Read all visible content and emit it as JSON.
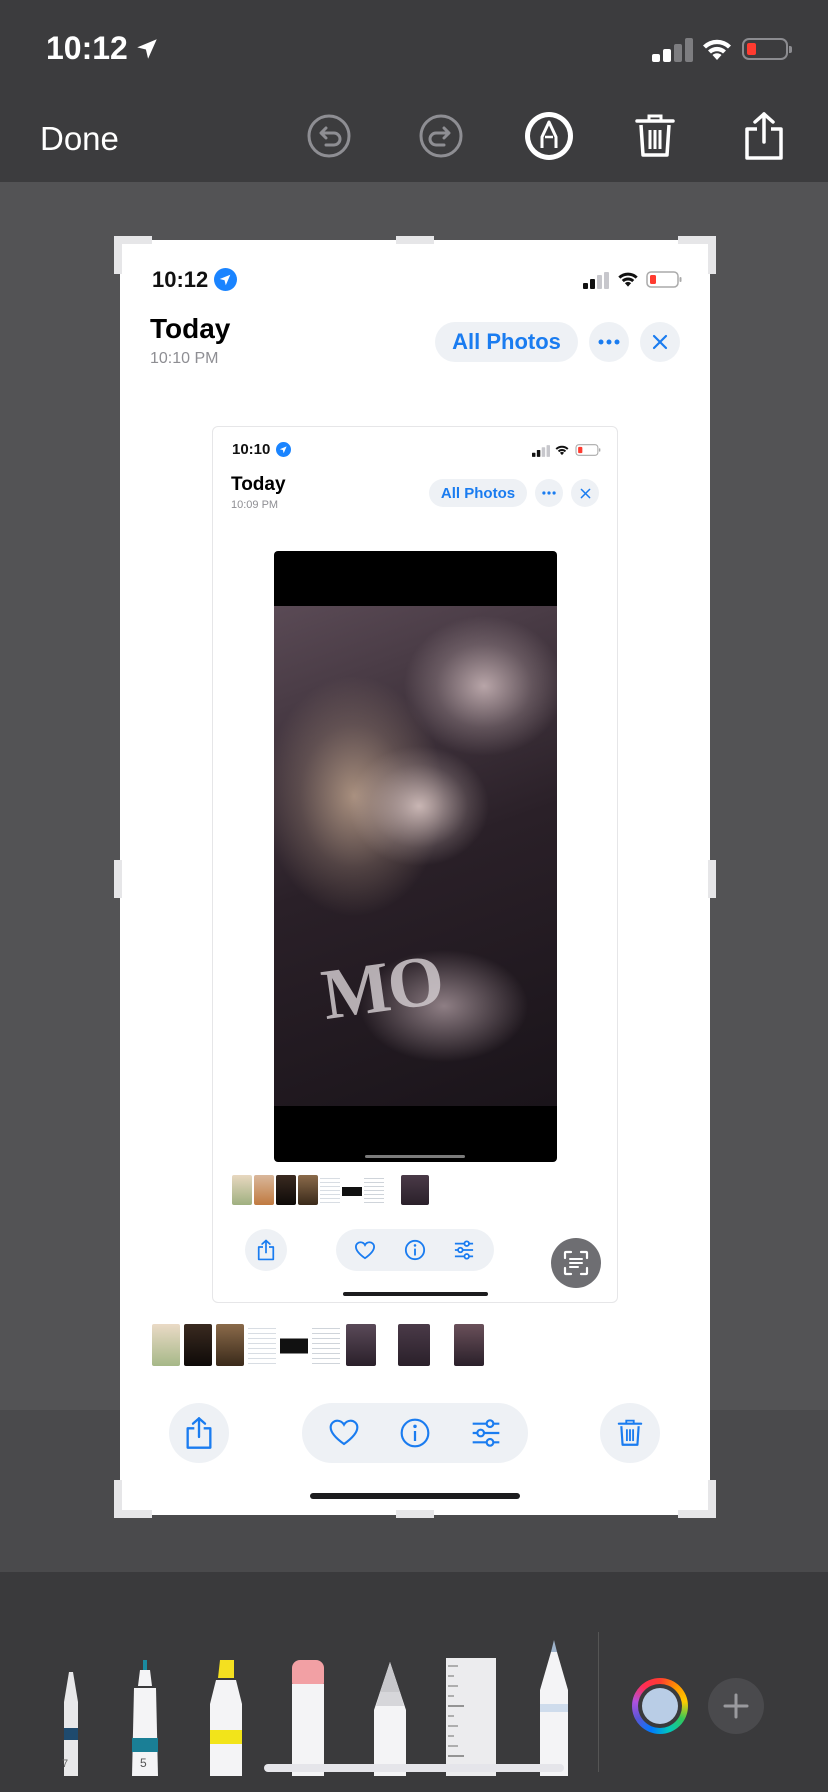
{
  "status_bar": {
    "time": "10:12"
  },
  "toolbar": {
    "done_label": "Done"
  },
  "screenshot": {
    "status_time": "10:12",
    "title": "Today",
    "subtitle": "10:10 PM",
    "all_photos_label": "All Photos",
    "nested": {
      "status_time": "10:10",
      "title": "Today",
      "subtitle": "10:09 PM",
      "all_photos_label": "All Photos",
      "photo_text": "MO"
    }
  },
  "tools": {
    "pen_label_1": "7",
    "pen_label_2": "5"
  },
  "colors": {
    "accent_blue": "#1a7cf0",
    "selected_color": "#b9cde6",
    "battery_red": "#ff3b30"
  }
}
